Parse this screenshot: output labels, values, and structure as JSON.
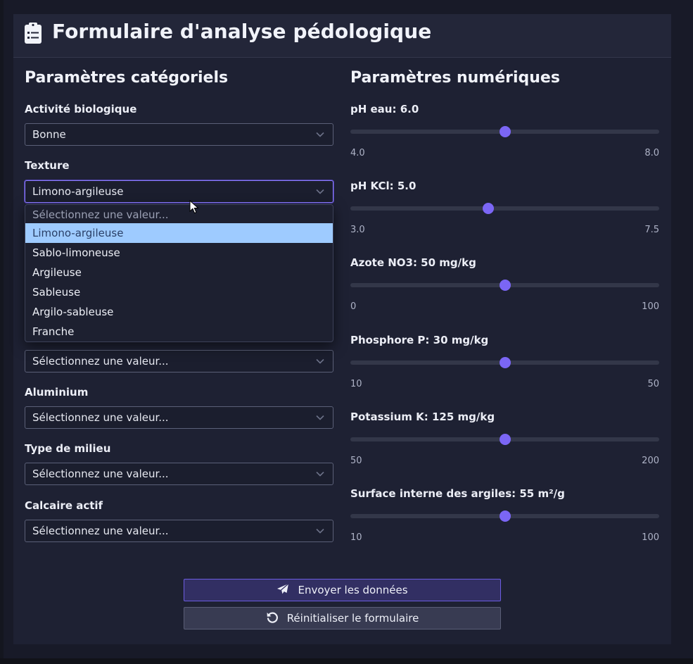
{
  "form": {
    "title": "Formulaire d'analyse pédologique",
    "categorical_title": "Paramètres catégoriels",
    "numeric_title": "Paramètres numériques"
  },
  "categorical": {
    "biological_activity": {
      "label": "Activité biologique",
      "value": "Bonne"
    },
    "texture": {
      "label": "Texture",
      "value": "Limono-argileuse",
      "options": [
        "Sélectionnez une valeur...",
        "Limono-argileuse",
        "Sablo-limoneuse",
        "Argileuse",
        "Sableuse",
        "Argilo-sableuse",
        "Franche"
      ]
    },
    "hidden_field_value": "Sélectionnez une valeur...",
    "aluminium": {
      "label": "Aluminium",
      "value": "Sélectionnez une valeur..."
    },
    "environment_type": {
      "label": "Type de milieu",
      "value": "Sélectionnez une valeur..."
    },
    "active_limestone": {
      "label": "Calcaire actif",
      "value": "Sélectionnez une valeur..."
    }
  },
  "numeric": [
    {
      "label": "pH eau: 6.0",
      "min_label": "4.0",
      "max_label": "8.0",
      "min": 4.0,
      "max": 8.0,
      "value": 6.0
    },
    {
      "label": "pH KCl: 5.0",
      "min_label": "3.0",
      "max_label": "7.5",
      "min": 3.0,
      "max": 7.5,
      "value": 5.0
    },
    {
      "label": "Azote NO3: 50 mg/kg",
      "min_label": "0",
      "max_label": "100",
      "min": 0,
      "max": 100,
      "value": 50
    },
    {
      "label": "Phosphore P: 30 mg/kg",
      "min_label": "10",
      "max_label": "50",
      "min": 10,
      "max": 50,
      "value": 30
    },
    {
      "label": "Potassium K: 125 mg/kg",
      "min_label": "50",
      "max_label": "200",
      "min": 50,
      "max": 200,
      "value": 125
    },
    {
      "label": "Surface interne des argiles: 55 m²/g",
      "min_label": "10",
      "max_label": "100",
      "min": 10,
      "max": 100,
      "value": 55
    }
  ],
  "buttons": {
    "submit": "Envoyer les données",
    "reset": "Réinitialiser le formulaire"
  },
  "colors": {
    "accent": "#7b66f5",
    "selected_option": "#9ecbff",
    "background": "#1e2133"
  },
  "icons": {
    "header": "clipboard-icon",
    "submit": "paper-plane-icon",
    "reset": "undo-icon",
    "select": "chevron-down-icon"
  }
}
